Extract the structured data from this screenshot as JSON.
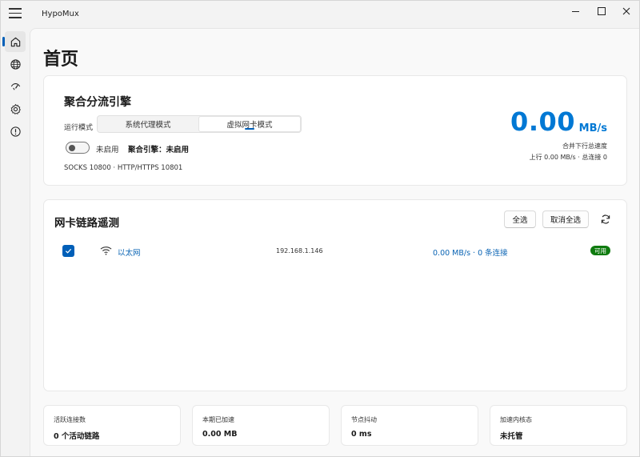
{
  "app": {
    "title": "HypoMux"
  },
  "nav": {
    "items": [
      {
        "icon": "home-icon",
        "active": true
      },
      {
        "icon": "globe-icon",
        "active": false
      },
      {
        "icon": "speedometer-icon",
        "active": false
      },
      {
        "icon": "gear-icon",
        "active": false
      },
      {
        "icon": "info-icon",
        "active": false
      }
    ]
  },
  "page": {
    "title": "首页"
  },
  "engine": {
    "title": "聚合分流引擎",
    "mode_label": "运行模式",
    "modes": [
      "系统代理模式",
      "虚拟网卡模式"
    ],
    "selected_mode": "虚拟网卡模式",
    "toggle_label": "未启用",
    "status_label": "聚合引擎：",
    "status_value": "未启用",
    "socks_info": "SOCKS 10800 · HTTP/HTTPS 10801",
    "speed_value": "0.00",
    "speed_unit": "MB/s",
    "speed_caption": "合并下行总速度",
    "speed_detail": "上行 0.00 MB/s · 总连接 0"
  },
  "probe": {
    "title": "网卡链路遥测",
    "select_all_label": "全选",
    "deselect_all_label": "取消全选",
    "interfaces": [
      {
        "name": "以太网",
        "ip": "192.168.1.146",
        "speed": "0.00 MB/s · 0 条连接",
        "status": "可用",
        "checked": true
      }
    ]
  },
  "stats": [
    {
      "label": "活跃连接数",
      "value": "0 个活动链路"
    },
    {
      "label": "本期已加速",
      "value": "0.00 MB"
    },
    {
      "label": "节点抖动",
      "value": "0 ms"
    },
    {
      "label": "加速内核态",
      "value": "未托管"
    }
  ],
  "colors": {
    "accent": "#0078d4",
    "accent_dark": "#005fb8",
    "available": "#0f7b0f"
  }
}
